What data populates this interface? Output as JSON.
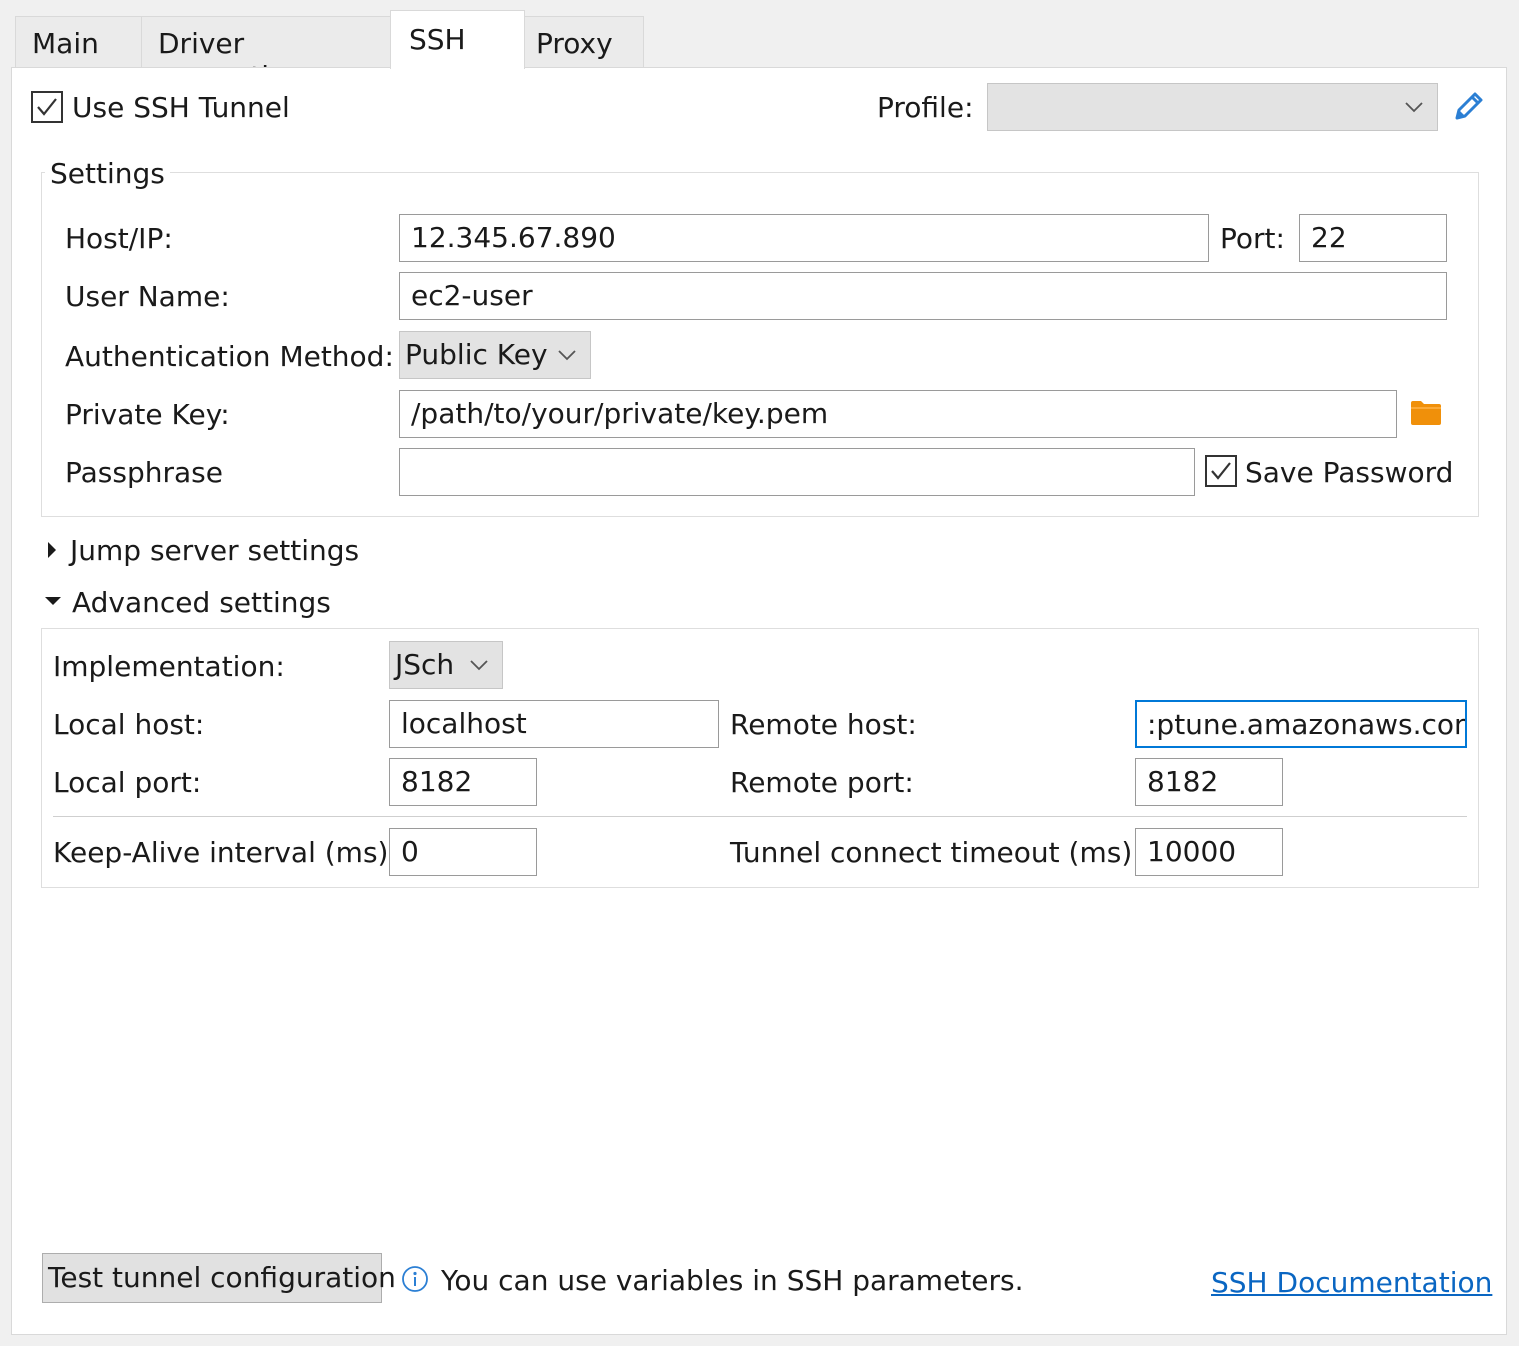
{
  "tabs": [
    {
      "label": "Main"
    },
    {
      "label": "Driver properties"
    },
    {
      "label": "SSH"
    },
    {
      "label": "Proxy"
    }
  ],
  "tunnel": {
    "use_ssh_label": "Use SSH Tunnel",
    "use_ssh_checked": true
  },
  "profile": {
    "label": "Profile:",
    "value": ""
  },
  "settings": {
    "legend": "Settings",
    "host_label": "Host/IP:",
    "host_value": "12.345.67.890",
    "port_label": "Port:",
    "port_value": "22",
    "user_label": "User Name:",
    "user_value": "ec2-user",
    "auth_label": "Authentication Method:",
    "auth_value": "Public Key",
    "key_label": "Private Key:",
    "key_value": "/path/to/your/private/key.pem",
    "pass_label": "Passphrase",
    "pass_value": "",
    "save_password_label": "Save Password",
    "save_password_checked": true
  },
  "jump": {
    "label": "Jump server settings",
    "expanded": false
  },
  "advanced": {
    "label": "Advanced settings",
    "expanded": true,
    "impl_label": "Implementation:",
    "impl_value": "JSch",
    "local_host_label": "Local host:",
    "local_host_value": "localhost",
    "remote_host_label": "Remote host:",
    "remote_host_value": ":ptune.amazonaws.com",
    "local_port_label": "Local port:",
    "local_port_value": "8182",
    "remote_port_label": "Remote port:",
    "remote_port_value": "8182",
    "keepalive_label": "Keep-Alive interval (ms):",
    "keepalive_value": "0",
    "timeout_label": "Tunnel connect timeout (ms):",
    "timeout_value": "10000"
  },
  "footer": {
    "test_button": "Test tunnel configuration",
    "info_text": "You can use variables in SSH parameters.",
    "doc_link": "SSH Documentation"
  },
  "colors": {
    "accent": "#0a66c2",
    "folder": "#f0900a",
    "pencil": "#2b7fd4"
  },
  "icons": [
    "chevron-down-icon",
    "pencil-icon",
    "folder-icon",
    "triangle-right-icon",
    "triangle-down-icon",
    "info-icon",
    "checkmark-icon"
  ]
}
